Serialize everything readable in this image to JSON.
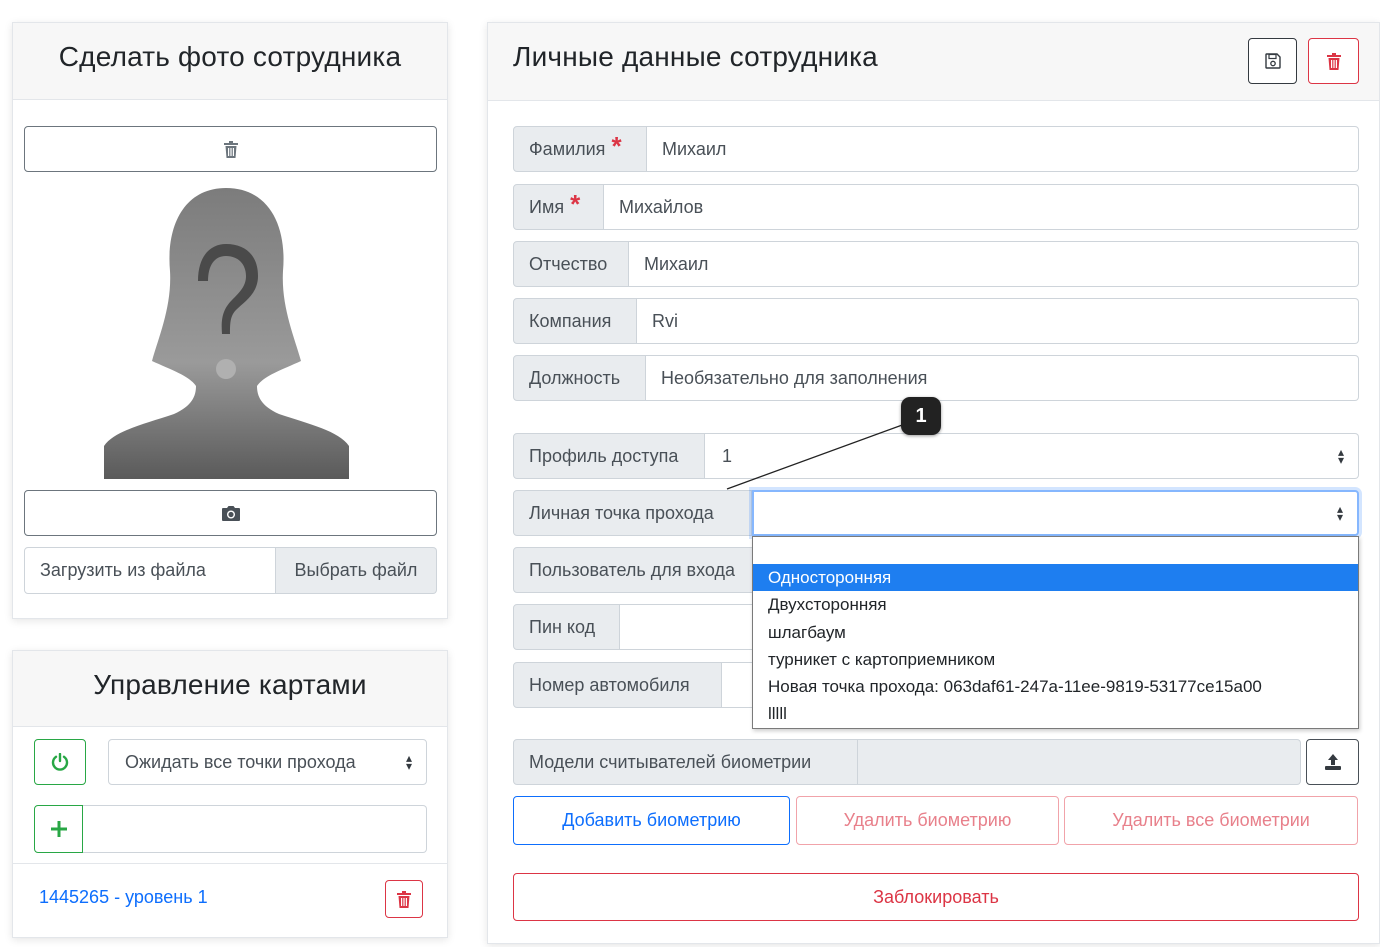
{
  "photo_panel": {
    "title": "Сделать фото сотрудника",
    "upload_label": "Загрузить из файла",
    "choose_file_label": "Выбрать файл"
  },
  "cards_panel": {
    "title": "Управление картами",
    "wait_select_value": "Ожидать все точки прохода",
    "card_item_label": "1445265 - уровень 1"
  },
  "employee_panel": {
    "title": "Личные данные сотрудника",
    "fields": {
      "last_name": {
        "label": "Фамилия",
        "required_mark": "*",
        "value": "Михаил"
      },
      "first_name": {
        "label": "Имя",
        "required_mark": "*",
        "value": "Михайлов"
      },
      "patronymic": {
        "label": "Отчество",
        "value": "Михаил"
      },
      "company": {
        "label": "Компания",
        "value": "Rvi"
      },
      "position": {
        "label": "Должность",
        "placeholder": "Необязательно для заполнения"
      },
      "access_profile": {
        "label": "Профиль доступа",
        "value": "1"
      },
      "personal_checkpoint": {
        "label": "Личная точка прохода",
        "value": ""
      },
      "login_user": {
        "label": "Пользователь для входа"
      },
      "pin_code": {
        "label": "Пин код"
      },
      "car_number": {
        "label": "Номер автомобиля"
      },
      "biometric_models": {
        "label": "Модели считывателей биометрии"
      }
    },
    "dropdown_options": [
      "",
      "Односторонняя",
      "Двухсторонняя",
      "шлагбаум",
      "турникет с картоприемником",
      "Новая точка прохода: 063daf61-247a-11ee-9819-53177ce15a00",
      "lllll"
    ],
    "dropdown_selected_index": 1,
    "buttons": {
      "add_biometry": "Добавить биометрию",
      "delete_biometry": "Удалить биометрию",
      "delete_all_biometry": "Удалить все биометрии",
      "block": "Заблокировать"
    }
  },
  "annotation": {
    "badge": "1"
  },
  "colors": {
    "primary": "#0d6efd",
    "danger": "#dc3545",
    "success": "#28a745",
    "highlight": "#1e7ef0",
    "input_group_bg": "#e9ecef"
  },
  "icons": {
    "trash": "trash-icon",
    "camera": "camera-icon",
    "save": "save-icon",
    "power": "power-icon",
    "plus": "plus-icon",
    "upload": "upload-icon",
    "avatar": "unknown-person-silhouette"
  }
}
